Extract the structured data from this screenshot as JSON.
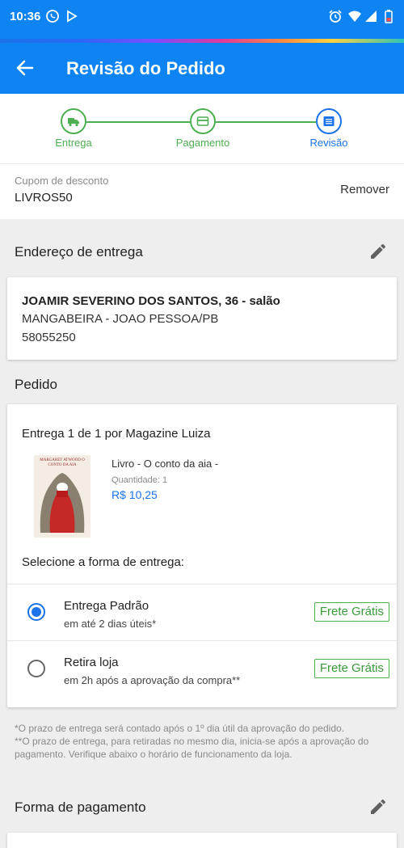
{
  "status_bar": {
    "time": "10:36"
  },
  "app_bar": {
    "title": "Revisão do Pedido"
  },
  "stepper": {
    "steps": [
      {
        "label": "Entrega",
        "icon": "truck-icon",
        "color": "#4caf50"
      },
      {
        "label": "Pagamento",
        "icon": "card-icon",
        "color": "#4caf50"
      },
      {
        "label": "Revisão",
        "icon": "list-icon",
        "color": "#1a73e8"
      }
    ]
  },
  "coupon": {
    "label": "Cupom de desconto",
    "code": "LIVROS50",
    "remove_label": "Remover"
  },
  "address": {
    "section_title": "Endereço de entrega",
    "line1": "JOAMIR SEVERINO DOS SANTOS, 36 - salão",
    "line2": "MANGABEIRA - JOAO PESSOA/PB",
    "line3": "58055250"
  },
  "order": {
    "section_title": "Pedido",
    "seller": "Entrega 1 de 1 por Magazine Luiza",
    "product": {
      "name": "Livro - O conto da aia -",
      "quantity": "Quantidade: 1",
      "price": "R$ 10,25",
      "cover_title": "MARGARET ATWOOD O CONTO DA AIA"
    },
    "shipping_question": "Selecione a forma de entrega:",
    "options": [
      {
        "title": "Entrega Padrão",
        "subtitle": "em até 2 dias úteis*",
        "badge": "Frete Grátis",
        "selected": true
      },
      {
        "title": "Retira loja",
        "subtitle": "em 2h após a aprovação da compra**",
        "badge": "Frete Grátis",
        "selected": false
      }
    ]
  },
  "notes": {
    "line1": "*O prazo de entrega será contado após o 1º dia útil da aprovação do pedido.",
    "line2": "**O prazo de entrega, para retiradas no mesmo dia, inicia-se após a aprovação do pagamento. Verifique abaixo o horário de funcionamento da loja."
  },
  "payment": {
    "section_title": "Forma de pagamento"
  },
  "colors": {
    "primary": "#0d84f2",
    "success": "#4caf50",
    "accent": "#1a73e8"
  }
}
